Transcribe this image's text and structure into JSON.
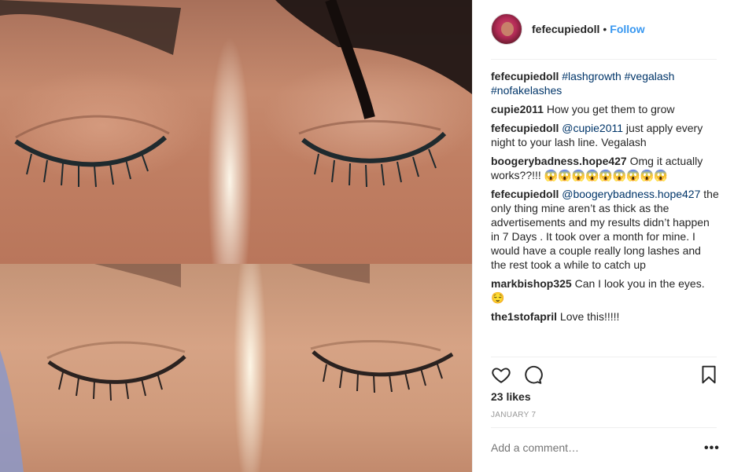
{
  "post": {
    "username": "fefecupiedoll",
    "dot": "•",
    "follow_label": "Follow"
  },
  "comments": [
    {
      "user": "fefecupiedoll",
      "parts": [
        {
          "t": "tag",
          "v": "#lashgrowth"
        },
        {
          "t": "text",
          "v": " "
        },
        {
          "t": "tag",
          "v": "#vegalash"
        },
        {
          "t": "text",
          "v": " "
        },
        {
          "t": "tag",
          "v": "#nofakelashes"
        }
      ]
    },
    {
      "user": "cupie2011",
      "parts": [
        {
          "t": "text",
          "v": "How you get them to grow"
        }
      ]
    },
    {
      "user": "fefecupiedoll",
      "parts": [
        {
          "t": "tag",
          "v": "@cupie2011"
        },
        {
          "t": "text",
          "v": " just apply every night to your lash line. Vegalash"
        }
      ]
    },
    {
      "user": "boogerybadness.hope427",
      "parts": [
        {
          "t": "text",
          "v": "Omg it actually works??!!! 😱😱😱😱😱😱😱😱😱"
        }
      ]
    },
    {
      "user": "fefecupiedoll",
      "parts": [
        {
          "t": "tag",
          "v": "@boogerybadness.hope427"
        },
        {
          "t": "text",
          "v": " the only thing mine aren’t as thick as the advertisements and my results didn’t happen in 7 Days . It took over a month for mine. I would have a couple really long lashes and the rest took a while to catch up"
        }
      ]
    },
    {
      "user": "markbishop325",
      "parts": [
        {
          "t": "text",
          "v": "Can I look you in the eyes. 😌"
        }
      ]
    },
    {
      "user": "the1stofapril",
      "parts": [
        {
          "t": "text",
          "v": "Love this!!!!!"
        }
      ]
    }
  ],
  "actions": {
    "like_icon": "heart-icon",
    "comment_icon": "comment-icon",
    "save_icon": "bookmark-icon"
  },
  "likes_label": "23 likes",
  "date_label": "JANUARY 7",
  "add_comment_placeholder": "Add a comment…",
  "more_label": "•••",
  "colors": {
    "link": "#3897f0",
    "hashtag": "#003569",
    "text": "#262626",
    "muted": "#999999"
  }
}
